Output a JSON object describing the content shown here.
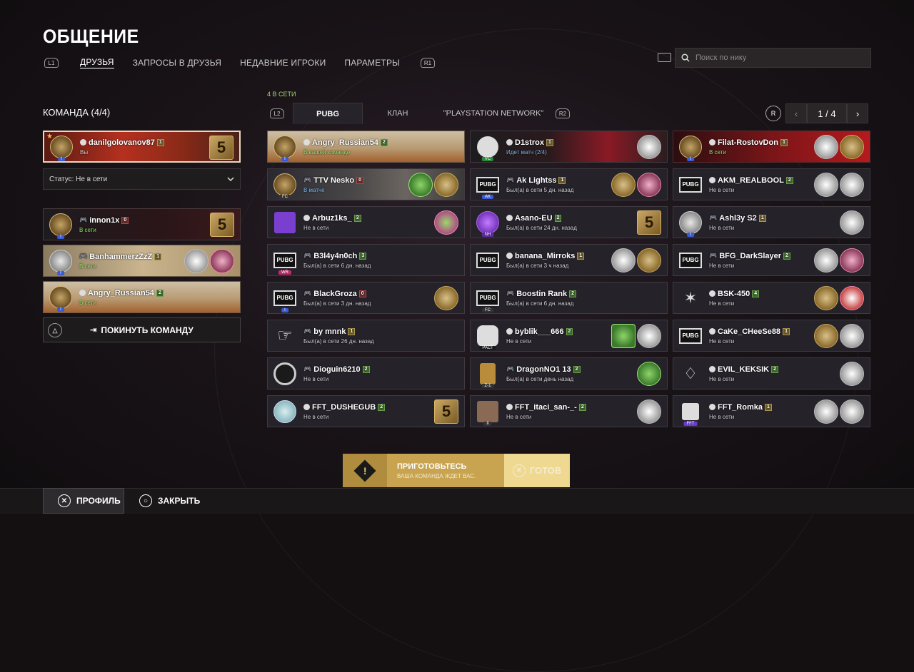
{
  "page": {
    "title": "ОБЩЕНИЕ"
  },
  "nav": {
    "left_key": "L1",
    "right_key": "R1",
    "tabs": [
      "ДРУЗЬЯ",
      "ЗАПРОСЫ В ДРУЗЬЯ",
      "НЕДАВНИЕ ИГРОКИ",
      "ПАРАМЕТРЫ"
    ]
  },
  "search": {
    "placeholder": "Поиск по нику"
  },
  "team": {
    "label": "КОМАНДА (4/4)",
    "leader": {
      "name": "danilgolovanov87",
      "level": "1",
      "status": "Вы"
    },
    "status_select": "Статус: Не в сети",
    "members": [
      {
        "name": "innon1x",
        "level": "0",
        "status": "В сети"
      },
      {
        "name": "BanhammerzZzZ",
        "level": "1",
        "status": "В сети"
      },
      {
        "name": "Angry_Russian54",
        "level": "2",
        "status": "В сети"
      }
    ],
    "leave_button": "ПОКИНУТЬ КОМАНДУ",
    "leave_key": "△"
  },
  "friends": {
    "online_count": "4 В СЕТИ",
    "left_key": "L2",
    "right_key": "R2",
    "tabs": [
      "PUBG",
      "КЛАН",
      "\"PLAYSTATION NETWORK\""
    ],
    "page_key": "R",
    "page": "1 / 4",
    "cards": [
      {
        "name": "Angry_Russian54",
        "level": "2",
        "status": "В вашей команде"
      },
      {
        "name": "D1strox",
        "level": "1",
        "status": "Идет матч (2/4)"
      },
      {
        "name": "Filat-RostovDon",
        "level": "1",
        "status": "В сети"
      },
      {
        "name": "TTV Nesko",
        "level": "0",
        "status": "В матче"
      },
      {
        "name": "Ak Lightss",
        "level": "1",
        "status": "Был(а) в сети 5 дн. назад"
      },
      {
        "name": "AKM_REALBOOL",
        "level": "2",
        "status": "Не в сети"
      },
      {
        "name": "Arbuz1ks_",
        "level": "3",
        "status": "Не в сети"
      },
      {
        "name": "Asano-EU",
        "level": "2",
        "status": "Был(а) в сети 24 дн. назад"
      },
      {
        "name": "Ashl3y S2",
        "level": "1",
        "status": "Не в сети"
      },
      {
        "name": "B3l4y4n0ch",
        "level": "3",
        "status": "Был(а) в сети 6 дн. назад"
      },
      {
        "name": "banana_Mirroks",
        "level": "1",
        "status": "Был(а) в сети 3 ч назад"
      },
      {
        "name": "BFG_DarkSlayer",
        "level": "2",
        "status": "Не в сети"
      },
      {
        "name": "BlackGroza",
        "level": "0",
        "status": "Был(а) в сети 3 дн. назад"
      },
      {
        "name": "Boostin Rank",
        "level": "2",
        "status": "Был(а) в сети 6 дн. назад"
      },
      {
        "name": "BSK-450",
        "level": "4",
        "status": "Не в сети"
      },
      {
        "name": "by mnnk",
        "level": "1",
        "status": "Был(а) в сети 26 дн. назад"
      },
      {
        "name": "byblik___666",
        "level": "2",
        "status": "Не в сети"
      },
      {
        "name": "CaKe_CHeeSe88",
        "level": "1",
        "status": "Не в сети"
      },
      {
        "name": "Dioguin6210",
        "level": "2",
        "status": "Не в сети"
      },
      {
        "name": "DragonNO1 13",
        "level": "2",
        "status": "Был(а) в сети день назад"
      },
      {
        "name": "EVIL_KEKSIK",
        "level": "2",
        "status": "Не в сети"
      },
      {
        "name": "FFT_DUSHEGUB",
        "level": "2",
        "status": "Не в сети"
      },
      {
        "name": "FFT_itaci_san-_-",
        "level": "2",
        "status": "Не в сети"
      },
      {
        "name": "FFT_Romka",
        "level": "1",
        "status": "Не в сети"
      }
    ]
  },
  "banner": {
    "title": "ПРИГОТОВЬТЕСЬ",
    "subtitle": "ВАША КОМАНДА ЖДЕТ ВАС.",
    "ready": "ГОТОВ"
  },
  "footer": {
    "profile": "ПРОФИЛЬ",
    "close": "ЗАКРЫТЬ"
  },
  "colors": {
    "online": "#8ee06a",
    "accent_gold": "#c8a450",
    "ready_yellow": "#efd890"
  }
}
